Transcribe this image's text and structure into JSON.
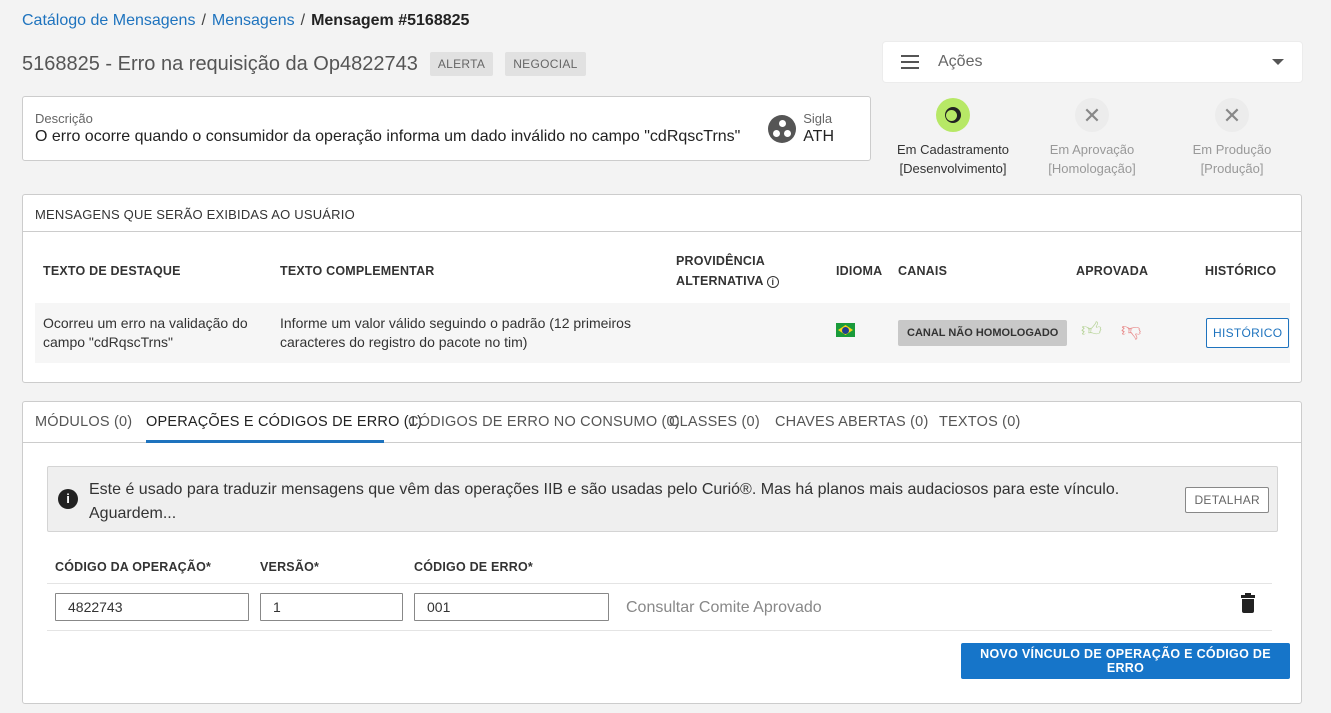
{
  "breadcrumb": {
    "items": [
      "Catálogo de Mensagens",
      "Mensagens"
    ],
    "current": "Mensagem #5168825",
    "sep": "/"
  },
  "header": {
    "title": "5168825 - Erro na requisição da Op4822743",
    "tags": [
      "ALERTA",
      "NEGOCIAL"
    ]
  },
  "acoes": {
    "label": "Ações"
  },
  "descricao": {
    "label": "Descrição",
    "value": "O erro ocorre quando o consumidor da operação informa um dado inválido no campo \"cdRqscTrns\"",
    "sigla_label": "Sigla",
    "sigla_value": "ATH"
  },
  "status_steps": [
    {
      "line1": "Em Cadastramento",
      "line2": "[Desenvolvimento]",
      "state": "active",
      "icon": "moon-icon"
    },
    {
      "line1": "Em Aprovação",
      "line2": "[Homologação]",
      "state": "inactive",
      "icon": "close-icon"
    },
    {
      "line1": "Em Produção",
      "line2": "[Produção]",
      "state": "inactive",
      "icon": "close-icon"
    }
  ],
  "mensagens": {
    "header": "MENSAGENS QUE SERÃO EXIBIDAS AO USUÁRIO",
    "columns": {
      "destaque": "TEXTO DE DESTAQUE",
      "complementar": "TEXTO COMPLEMENTAR",
      "providencia1": "PROVIDÊNCIA",
      "providencia2": "ALTERNATIVA",
      "idioma": "IDIOMA",
      "canais": "CANAIS",
      "aprovada": "APROVADA",
      "historico": "HISTÓRICO"
    },
    "row": {
      "destaque": "Ocorreu um erro na validação do campo \"cdRqscTrns\"",
      "complementar": "Informe um valor válido seguindo o padrão (12 primeiros caracteres do registro do pacote no tim)",
      "idioma_flag": "brazil-flag-icon",
      "canal_badge": "CANAL NÃO HOMOLOGADO",
      "historico_btn": "HISTÓRICO"
    }
  },
  "tabs": [
    "MÓDULOS (0)",
    "OPERAÇÕES E CÓDIGOS DE ERRO (1)",
    "CÓDIGOS DE ERRO NO CONSUMO (0)",
    "CLASSES (0)",
    "CHAVES ABERTAS (0)",
    "TEXTOS (0)"
  ],
  "active_tab": "OPERAÇÕES E CÓDIGOS DE ERRO (1)",
  "alert": {
    "text": "Este é usado para traduzir mensagens que vêm das operações IIB e são usadas pelo Curió®. Mas há planos mais audaciosos para este vínculo. Aguardem...",
    "button": "DETALHAR"
  },
  "form": {
    "labels": {
      "codigo_operacao": "CÓDIGO DA OPERAÇÃO*",
      "versao": "VERSÃO*",
      "codigo_erro": "CÓDIGO DE ERRO*"
    },
    "values": {
      "codigo_operacao": "4822743",
      "versao": "1",
      "codigo_erro": "001"
    },
    "consultar": "Consultar Comite Aprovado",
    "novo_btn": "NOVO VÍNCULO DE OPERAÇÃO E CÓDIGO DE ERRO"
  },
  "colors": {
    "link": "#1e73be",
    "primary_button": "#1675c9",
    "active_status": "#b7e866"
  }
}
